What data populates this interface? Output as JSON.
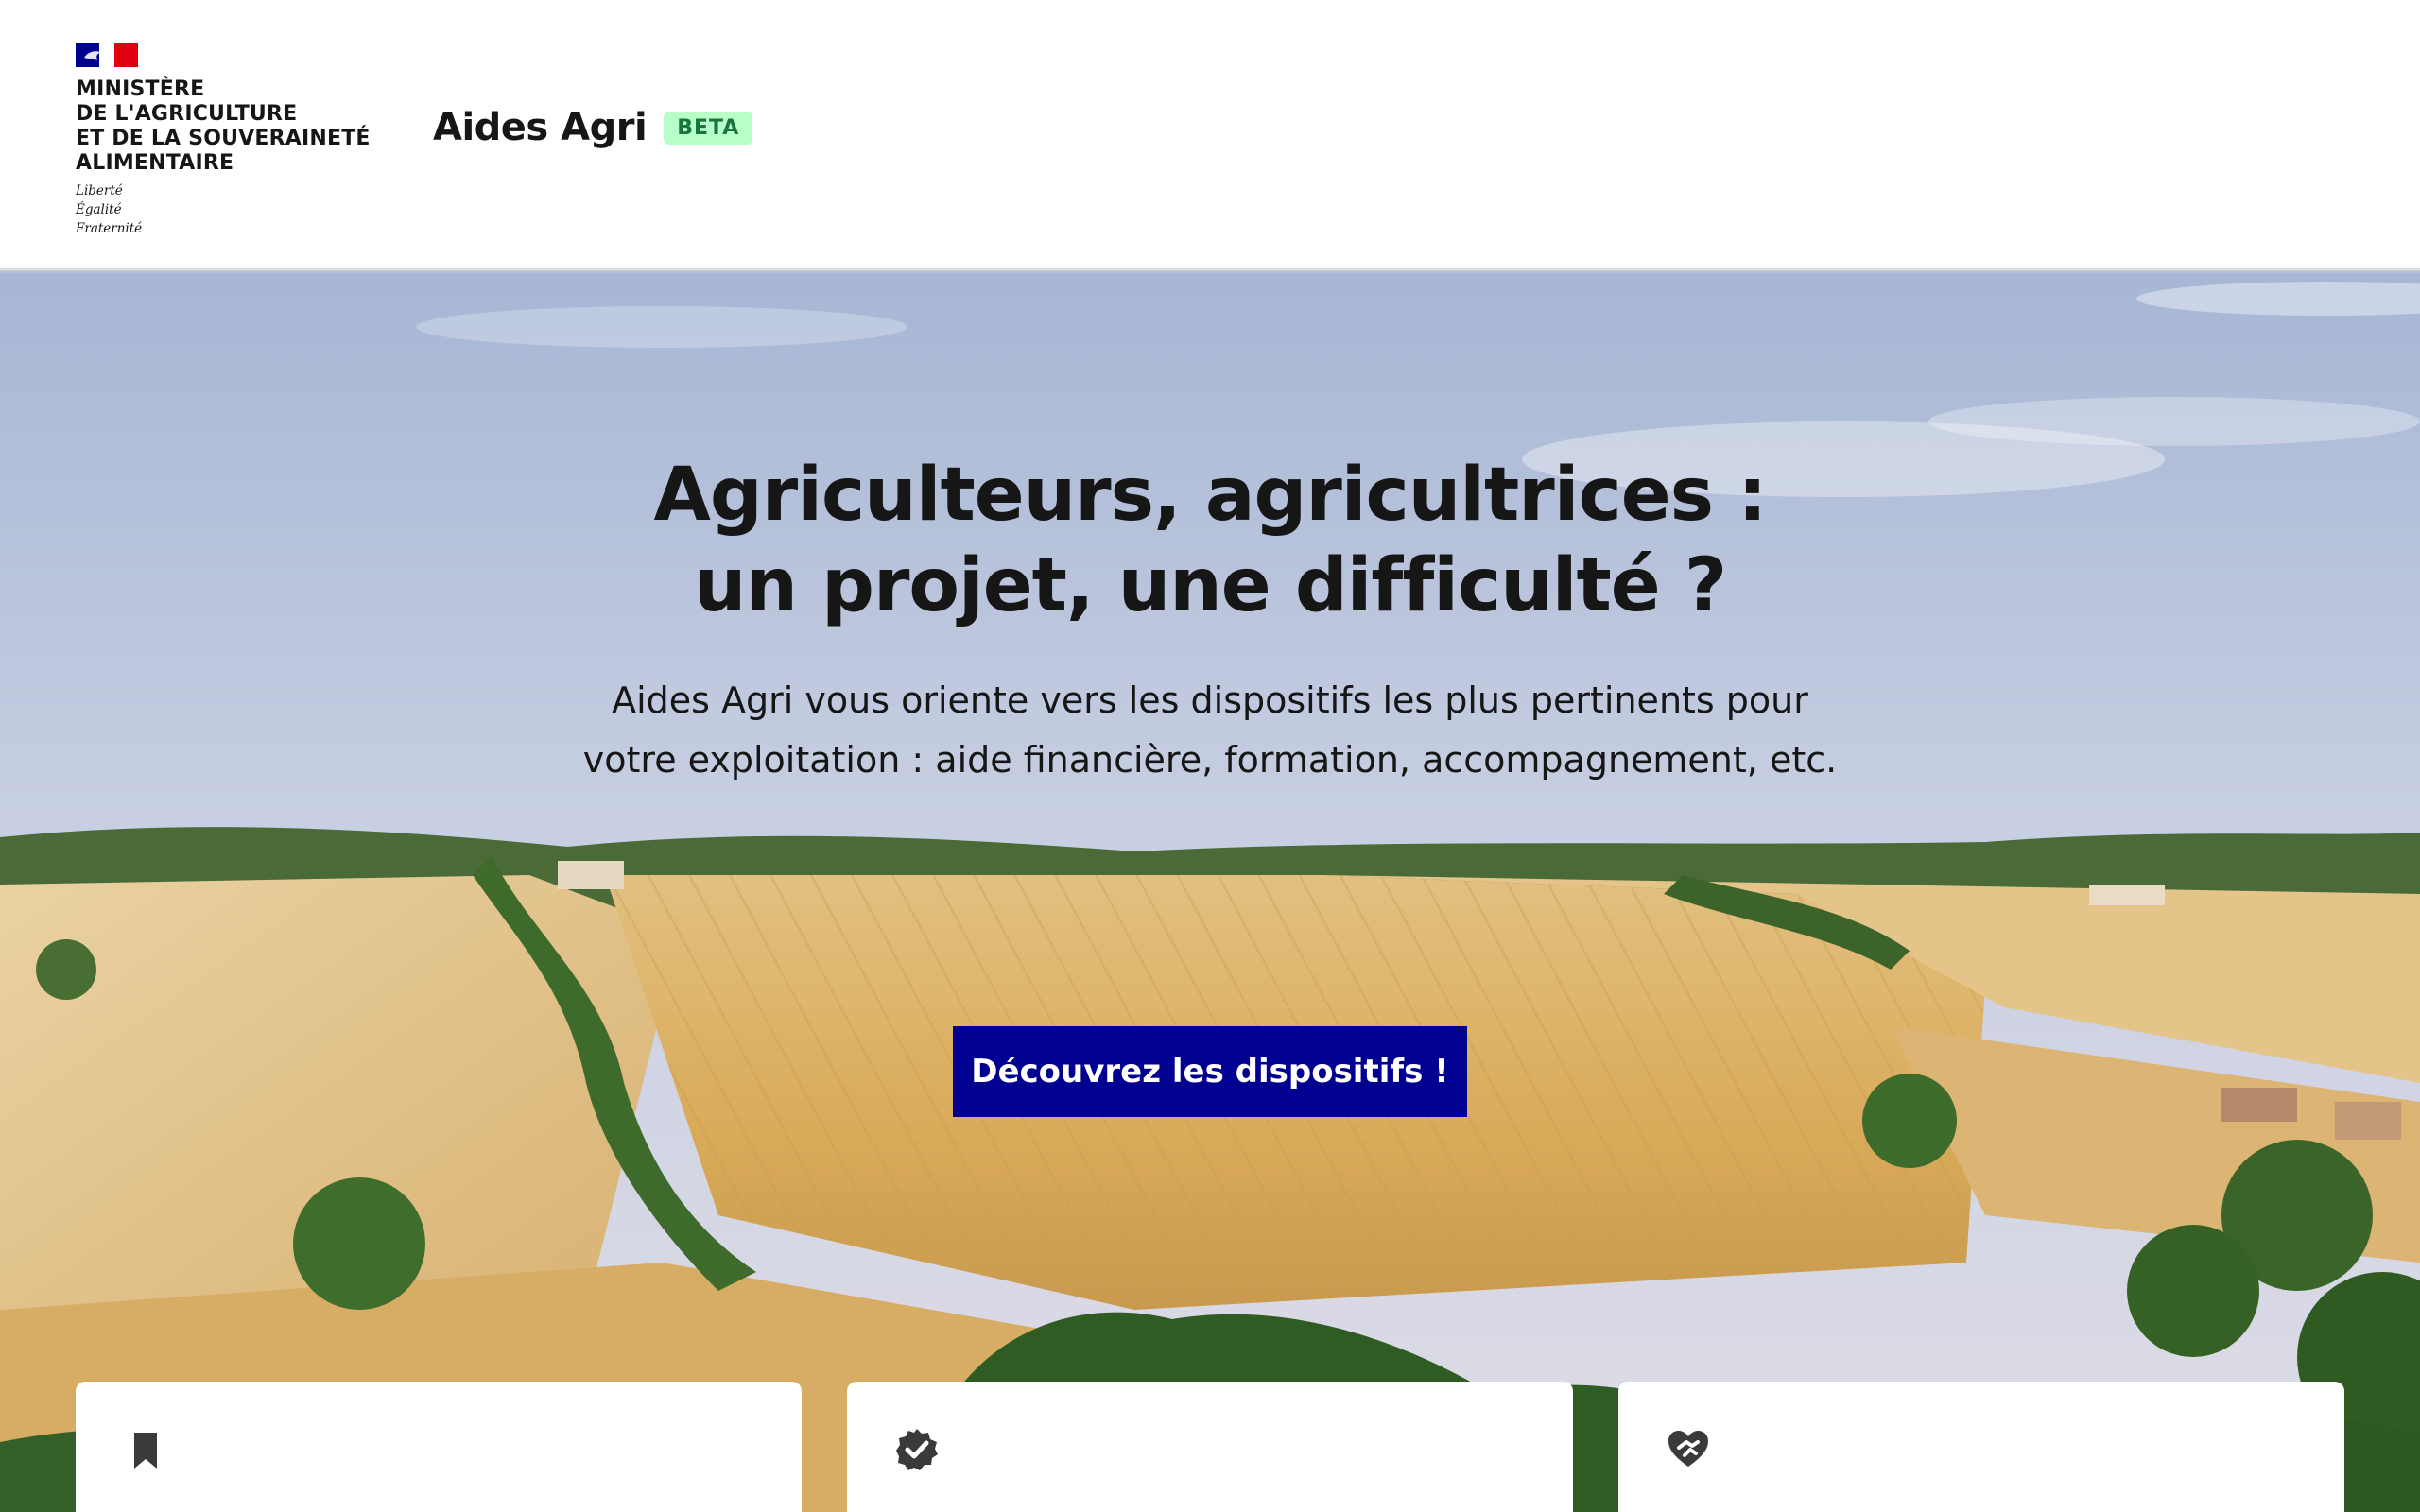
{
  "header": {
    "ministry_lines": [
      "MINISTÈRE",
      "DE L'AGRICULTURE",
      "ET DE LA SOUVERAINETÉ",
      "ALIMENTAIRE"
    ],
    "devise_lines": [
      "Liberté",
      "Égalité",
      "Fraternité"
    ],
    "service_title": "Aides Agri",
    "badge": "BETA"
  },
  "hero": {
    "title_lines": [
      "Agriculteurs, agricultrices :",
      "un projet, une difficulté ?"
    ],
    "subtitle_lines": [
      "Aides Agri vous oriente vers les dispositifs les plus pertinents pour",
      "votre exploitation : aide financière, formation, accompagnement, etc."
    ],
    "cta_label": "Découvrez les dispositifs !",
    "background": "aerial-view-of-golden-fields-and-trees"
  },
  "cards": [
    {
      "icon": "bookmark-icon"
    },
    {
      "icon": "verified-badge-icon"
    },
    {
      "icon": "heart-handshake-icon"
    }
  ],
  "colors": {
    "primary": "#000091",
    "beta_bg": "#b8fec9",
    "beta_text": "#18753c",
    "flag_red": "#e1000f"
  }
}
